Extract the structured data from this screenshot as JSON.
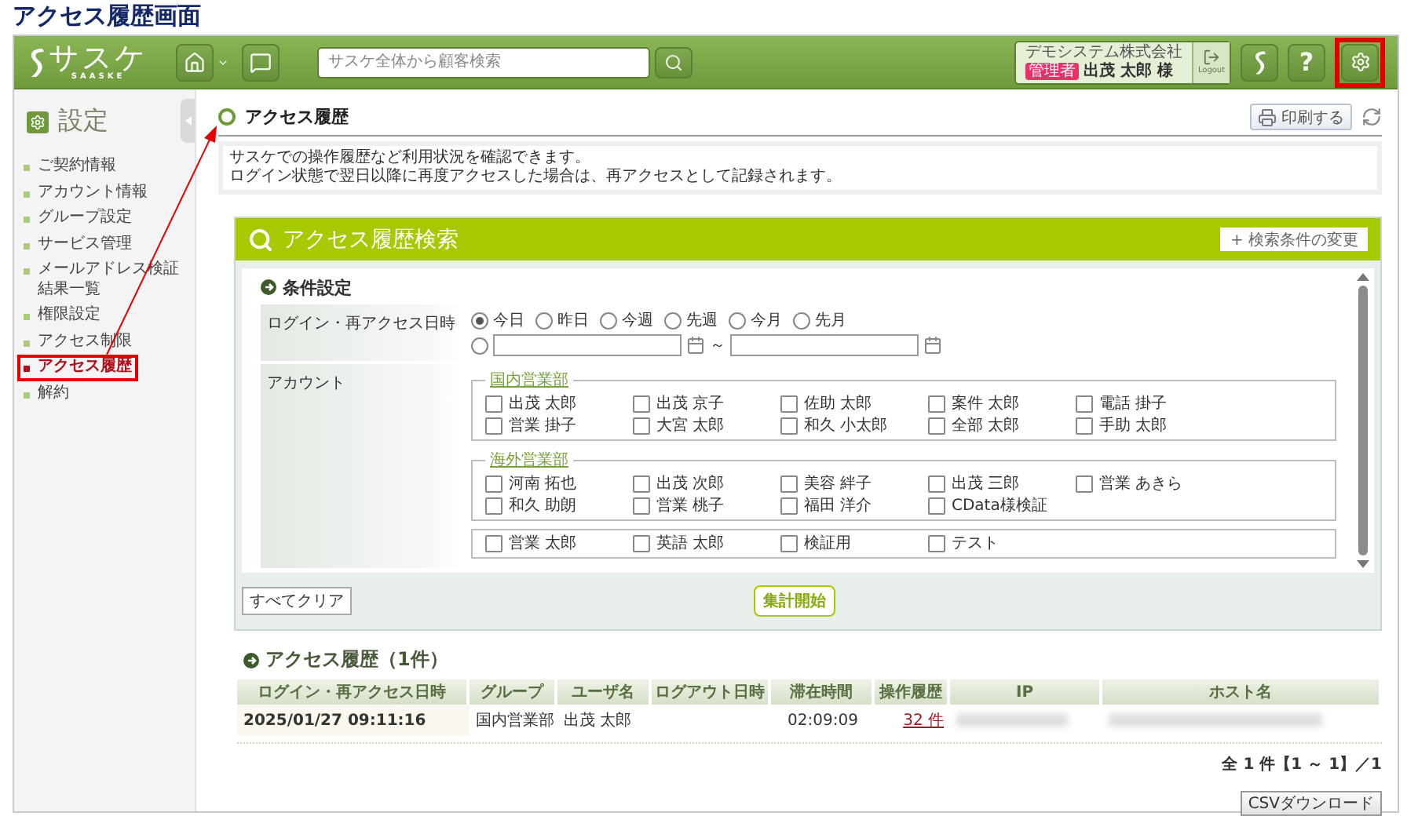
{
  "page_title": "アクセス履歴画面",
  "header": {
    "logo": "サスケ",
    "logo_sub": "SAASKE",
    "search": {
      "placeholder": "サスケ全体から顧客検索"
    },
    "user": {
      "company": "デモシステム株式会社",
      "role_badge": "管理者",
      "name": "出茂 太郎 様"
    },
    "logout_label": "Logout",
    "help_label": "?",
    "settings": {
      "highlighted": true
    }
  },
  "sidebar": {
    "title": "設定",
    "items": [
      {
        "label": "ご契約情報",
        "selected": false,
        "highlighted": false
      },
      {
        "label": "アカウント情報",
        "selected": false,
        "highlighted": false
      },
      {
        "label": "グループ設定",
        "selected": false,
        "highlighted": false
      },
      {
        "label": "サービス管理",
        "selected": false,
        "highlighted": false
      },
      {
        "label": "メールアドレス検証結果一覧",
        "selected": false,
        "highlighted": false
      },
      {
        "label": "権限設定",
        "selected": false,
        "highlighted": false
      },
      {
        "label": "アクセス制限",
        "selected": false,
        "highlighted": false
      },
      {
        "label": "アクセス履歴",
        "selected": true,
        "highlighted": true
      },
      {
        "label": "解約",
        "selected": false,
        "highlighted": false
      }
    ]
  },
  "page": {
    "heading": "アクセス履歴",
    "print_label": "印刷する",
    "description": [
      "サスケでの操作履歴など利用状況を確認できます。",
      "ログイン状態で翌日以降に再度アクセスした場合は、再アクセスとして記録されます。"
    ]
  },
  "search_panel": {
    "title": "アクセス履歴検索",
    "toggle_label": "+ 検索条件の変更",
    "section": "条件設定",
    "date_label": "ログイン・再アクセス日時",
    "periods": [
      {
        "label": "今日",
        "selected": true
      },
      {
        "label": "昨日",
        "selected": false
      },
      {
        "label": "今週",
        "selected": false
      },
      {
        "label": "先週",
        "selected": false
      },
      {
        "label": "今月",
        "selected": false
      },
      {
        "label": "先月",
        "selected": false
      }
    ],
    "range": {
      "selected": false,
      "separator": "～"
    },
    "account_label": "アカウント",
    "groups": [
      {
        "name": "国内営業部",
        "members": [
          {
            "name": "出茂 太郎",
            "checked": false
          },
          {
            "name": "出茂 京子",
            "checked": false
          },
          {
            "name": "佐助 太郎",
            "checked": false
          },
          {
            "name": "案件 太郎",
            "checked": false
          },
          {
            "name": "電話 掛子",
            "checked": false
          },
          {
            "name": "営業 掛子",
            "checked": false
          },
          {
            "name": "大宮 太郎",
            "checked": false
          },
          {
            "name": "和久 小太郎",
            "checked": false
          },
          {
            "name": "全部 太郎",
            "checked": false
          },
          {
            "name": "手助 太郎",
            "checked": false
          }
        ]
      },
      {
        "name": "海外営業部",
        "members": [
          {
            "name": "河南 拓也",
            "checked": false
          },
          {
            "name": "出茂 次郎",
            "checked": false
          },
          {
            "name": "美容 絆子",
            "checked": false
          },
          {
            "name": "出茂 三郎",
            "checked": false
          },
          {
            "name": "営業 あきら",
            "checked": false
          },
          {
            "name": "和久 助朗",
            "checked": false
          },
          {
            "name": "営業 桃子",
            "checked": false
          },
          {
            "name": "福田 洋介",
            "checked": false
          },
          {
            "name": "CData様検証",
            "checked": false
          }
        ]
      },
      {
        "members": [
          {
            "name": "営業 太郎",
            "checked": false
          },
          {
            "name": "英語 太郎",
            "checked": false
          },
          {
            "name": "検証用",
            "checked": false
          },
          {
            "name": "テスト",
            "checked": false
          }
        ]
      }
    ],
    "clear_label": "すべてクリア",
    "submit_label": "集計開始"
  },
  "results": {
    "heading": "アクセス履歴（1件）",
    "columns": [
      "ログイン・再アクセス日時",
      "グループ",
      "ユーザ名",
      "ログアウト日時",
      "滞在時間",
      "操作履歴",
      "IP",
      "ホスト名"
    ],
    "rows": [
      {
        "cells": [
          {
            "kind": "text",
            "text": "2025/01/27 09:11:16"
          },
          {
            "kind": "text",
            "text": "国内営業部"
          },
          {
            "kind": "text",
            "text": "出茂 太郎"
          },
          {
            "kind": "empty"
          },
          {
            "kind": "text",
            "text": "02:09:09"
          },
          {
            "kind": "link",
            "text": "32 件"
          },
          {
            "kind": "redacted"
          },
          {
            "kind": "redacted"
          }
        ]
      }
    ],
    "pagination": "全 1 件【1 ～ 1】／1",
    "csv_label": "CSVダウンロード"
  }
}
